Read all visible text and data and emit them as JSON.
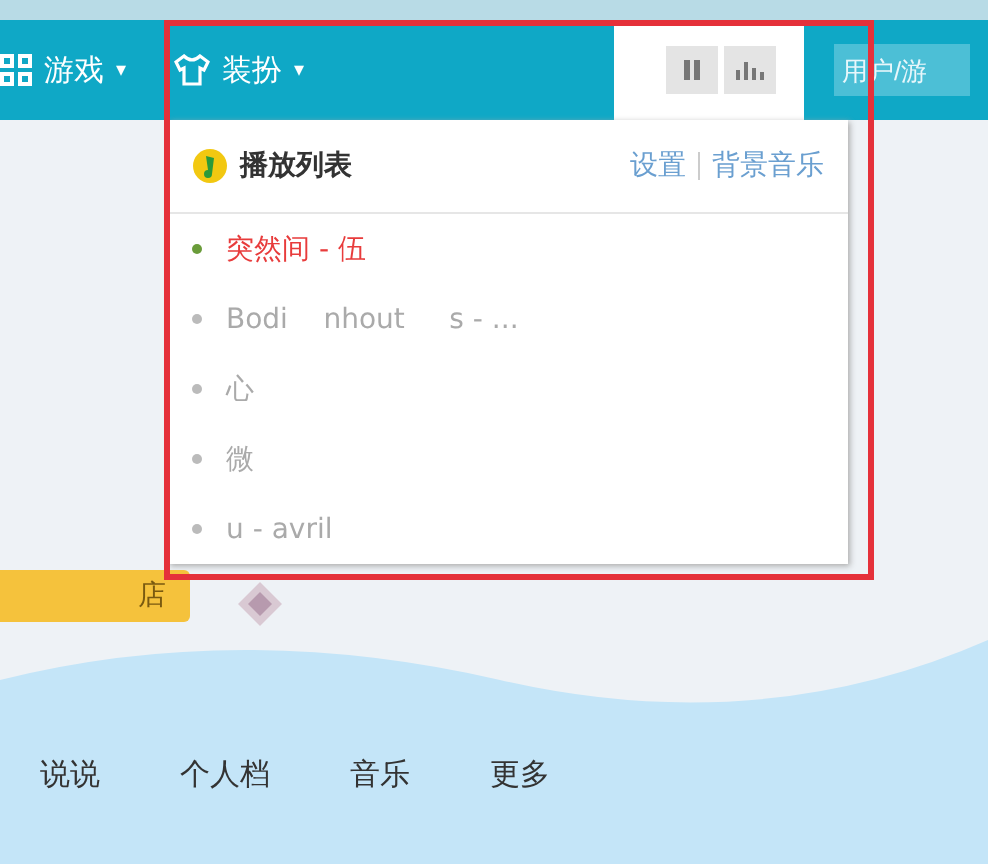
{
  "top_bar": {
    "games": {
      "label": "游戏",
      "caret": "▾"
    },
    "dress_up": {
      "label": "装扮",
      "caret": "▾"
    },
    "search": {
      "placeholder": "用户/游"
    }
  },
  "player": {
    "title": "播放列表",
    "links": [
      {
        "label": "设置"
      },
      {
        "label": "背景音乐"
      }
    ],
    "songs": [
      {
        "title": "突然间 - 伍",
        "playing": true
      },
      {
        "title": "Bodi    nhout     s - ...",
        "playing": false
      },
      {
        "title": "心",
        "playing": false
      },
      {
        "title": "微",
        "playing": false
      },
      {
        "title": "u - avril",
        "playing": false
      }
    ]
  },
  "badge": {
    "label": "店"
  },
  "nav": [
    {
      "label": "说说"
    },
    {
      "label": "个人档"
    },
    {
      "label": "音乐"
    },
    {
      "label": "更多"
    }
  ]
}
